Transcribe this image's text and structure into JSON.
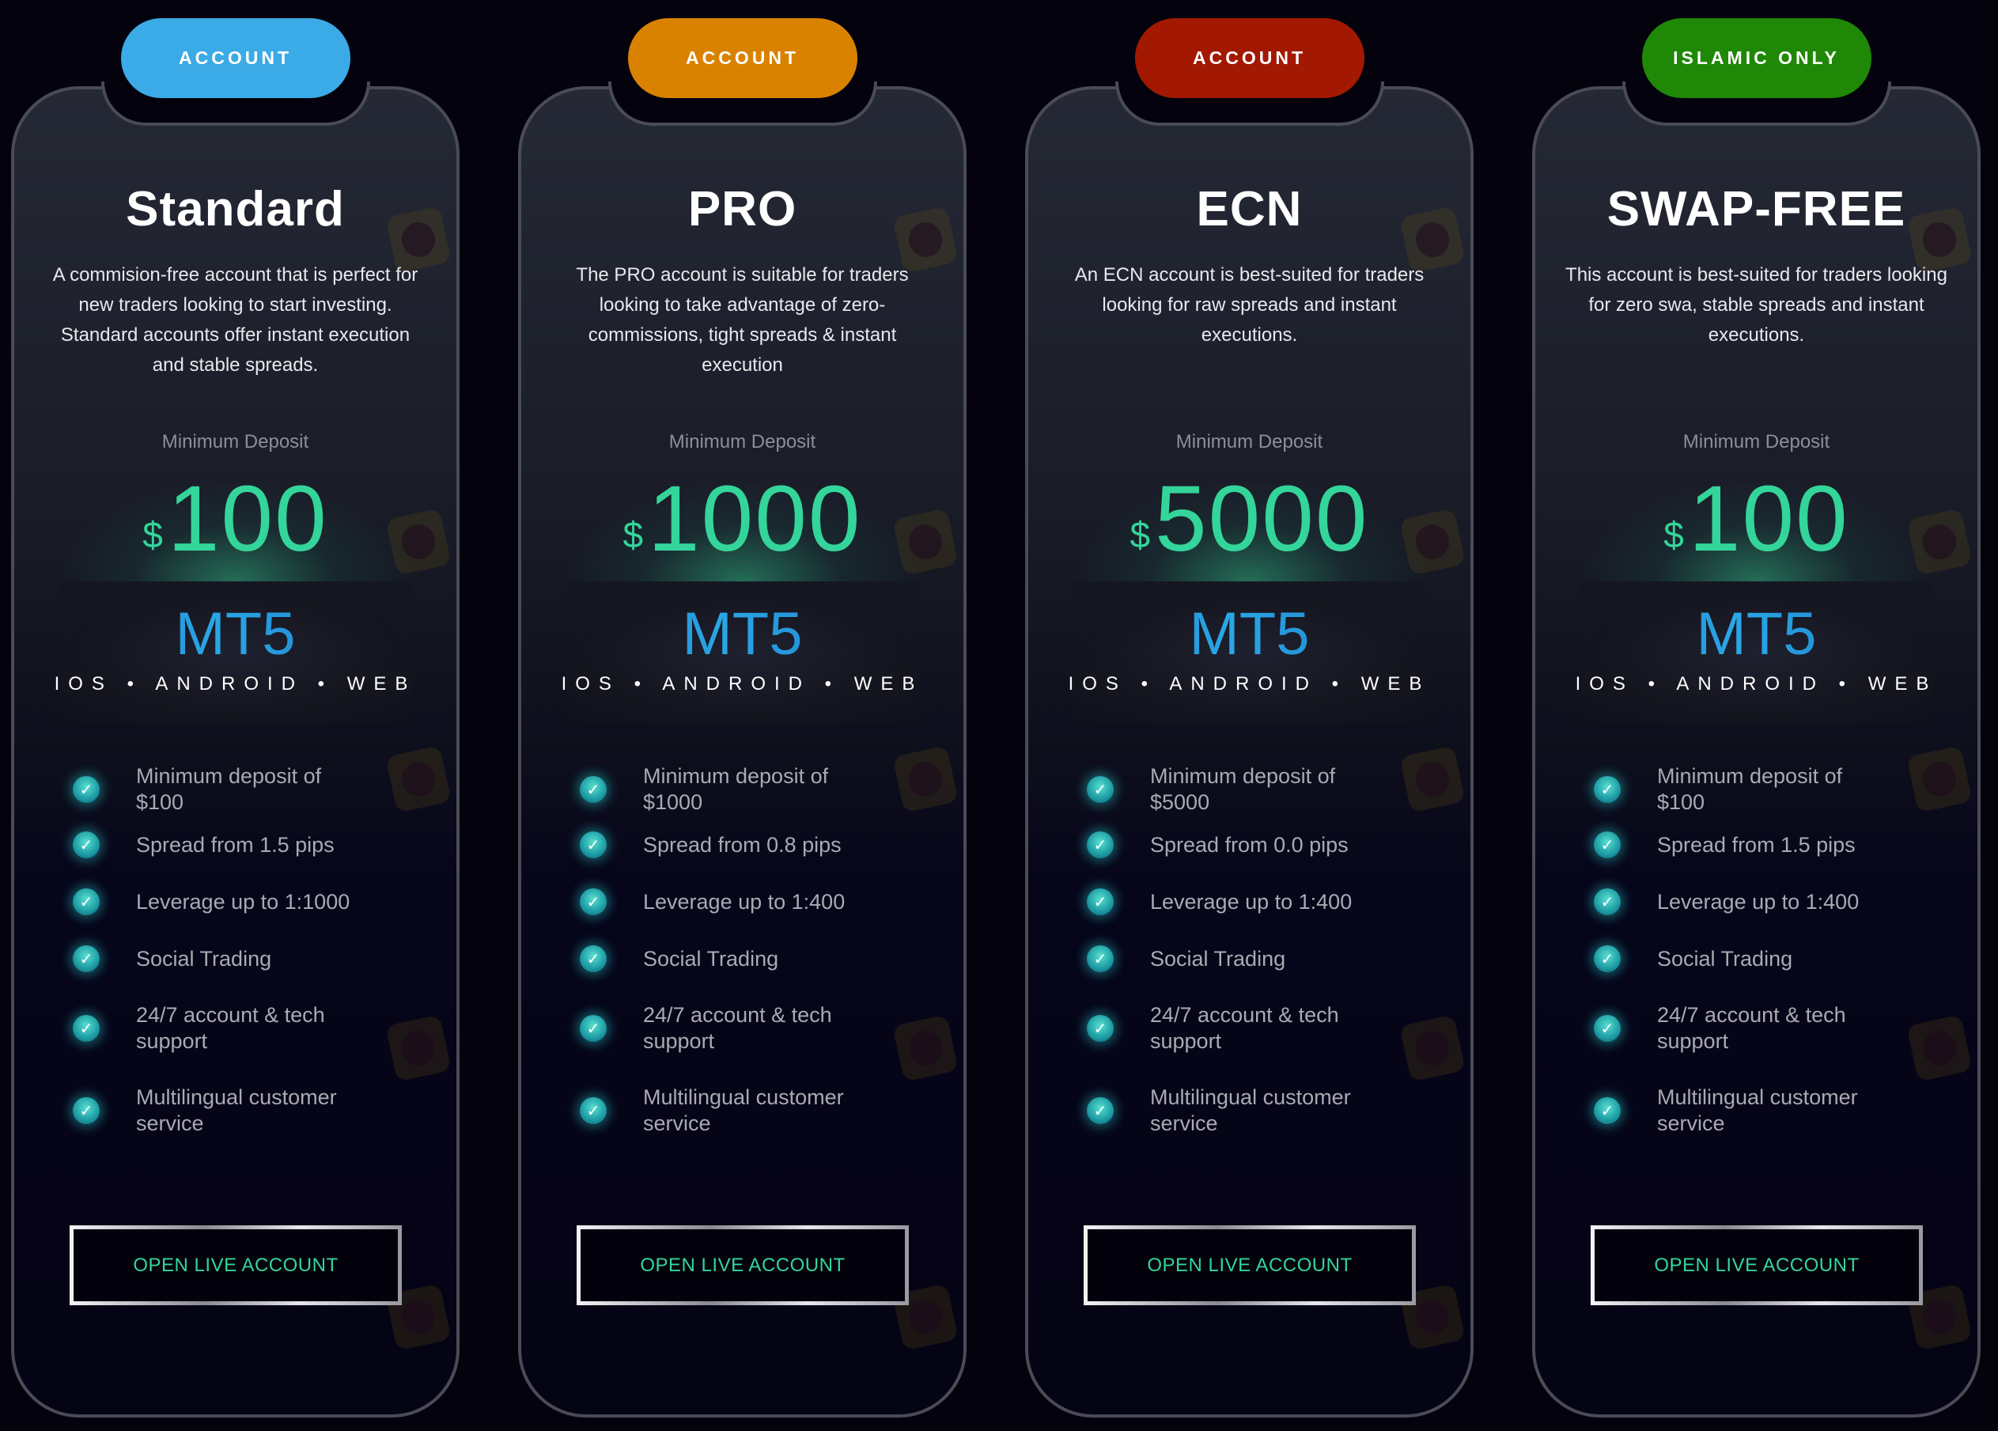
{
  "accent_colors": {
    "price_green": "#34d59a",
    "mt5_blue": "#2aa7e6",
    "check_teal": "#1c9aa3"
  },
  "cards": [
    {
      "badge": {
        "label": "ACCOUNT",
        "color": "#3aabe6"
      },
      "title": "Standard",
      "description": "A commision-free account that is perfect for new traders looking to start investing. Standard accounts offer instant execution and stable spreads.",
      "min_deposit_label": "Minimum Deposit",
      "currency_symbol": "$",
      "min_deposit_amount": "100",
      "platform": "MT5",
      "platforms_line": "IOS • ANDROID • WEB",
      "features": [
        "Minimum deposit of $100",
        "Spread from 1.5 pips",
        "Leverage up to 1:1000",
        "Social Trading",
        "24/7 account & tech support",
        "Multilingual customer service"
      ],
      "cta_label": "OPEN LIVE ACCOUNT"
    },
    {
      "badge": {
        "label": "ACCOUNT",
        "color": "#d98200"
      },
      "title": "PRO",
      "description": "The PRO account is suitable for traders looking to take advantage of zero-commissions, tight spreads & instant execution",
      "min_deposit_label": "Minimum Deposit",
      "currency_symbol": "$",
      "min_deposit_amount": "1000",
      "platform": "MT5",
      "platforms_line": "IOS • ANDROID • WEB",
      "features": [
        "Minimum deposit of $1000",
        "Spread from 0.8 pips",
        "Leverage up to 1:400",
        "Social Trading",
        "24/7 account & tech support",
        "Multilingual customer service"
      ],
      "cta_label": "OPEN LIVE ACCOUNT"
    },
    {
      "badge": {
        "label": "ACCOUNT",
        "color": "#a31800"
      },
      "title": "ECN",
      "description": "An ECN account is best-suited for traders looking for raw spreads and instant executions.",
      "min_deposit_label": "Minimum Deposit",
      "currency_symbol": "$",
      "min_deposit_amount": "5000",
      "platform": "MT5",
      "platforms_line": "IOS • ANDROID • WEB",
      "features": [
        "Minimum deposit of $5000",
        "Spread from 0.0 pips",
        "Leverage up to 1:400",
        "Social Trading",
        "24/7 account & tech support",
        "Multilingual customer service"
      ],
      "cta_label": "OPEN LIVE ACCOUNT"
    },
    {
      "badge": {
        "label": "ISLAMIC ONLY",
        "color": "#1f8806"
      },
      "title": "SWAP-FREE",
      "description": "This account is best-suited for traders looking for zero swa, stable spreads and instant executions.",
      "min_deposit_label": "Minimum Deposit",
      "currency_symbol": "$",
      "min_deposit_amount": "100",
      "platform": "MT5",
      "platforms_line": "IOS • ANDROID • WEB",
      "features": [
        "Minimum deposit of $100",
        "Spread from 1.5 pips",
        "Leverage up to 1:400",
        "Social Trading",
        "24/7 account & tech support",
        "Multilingual customer service"
      ],
      "cta_label": "OPEN LIVE ACCOUNT"
    }
  ]
}
